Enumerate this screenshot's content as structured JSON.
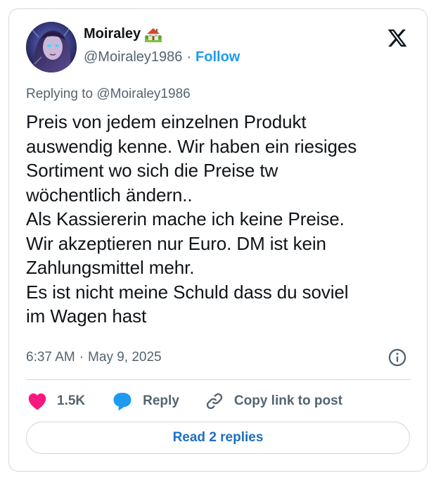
{
  "author": {
    "display_name": "Moiraley",
    "name_emoji": "house-with-garden-icon",
    "handle": "@Moiraley1986",
    "separator": "·",
    "follow_label": "Follow"
  },
  "platform": {
    "logo": "x-logo-icon"
  },
  "tweet": {
    "replying_prefix": "Replying to ",
    "replying_to": "@Moiraley1986",
    "lines": [
      "Preis von jedem einzelnen Produkt",
      "auswendig kenne. Wir haben ein riesiges",
      "Sortiment wo sich die Preise tw",
      "wöchentlich ändern..",
      "Als Kassiererin mache ich keine Preise.",
      "Wir akzeptieren nur Euro. DM ist kein",
      "Zahlungsmittel mehr.",
      "Es ist nicht meine Schuld dass du soviel",
      "im Wagen hast"
    ],
    "time": "6:37 AM",
    "date_separator": "·",
    "date": "May 9, 2025"
  },
  "actions": {
    "like_count": "1.5K",
    "reply_label": "Reply",
    "copy_label": "Copy link to post",
    "read_replies_label": "Read 2 replies"
  },
  "colors": {
    "accent": "#1d9bf0",
    "like": "#f91880",
    "text": "#0f1419",
    "muted": "#536471",
    "border": "#cfd9de"
  }
}
